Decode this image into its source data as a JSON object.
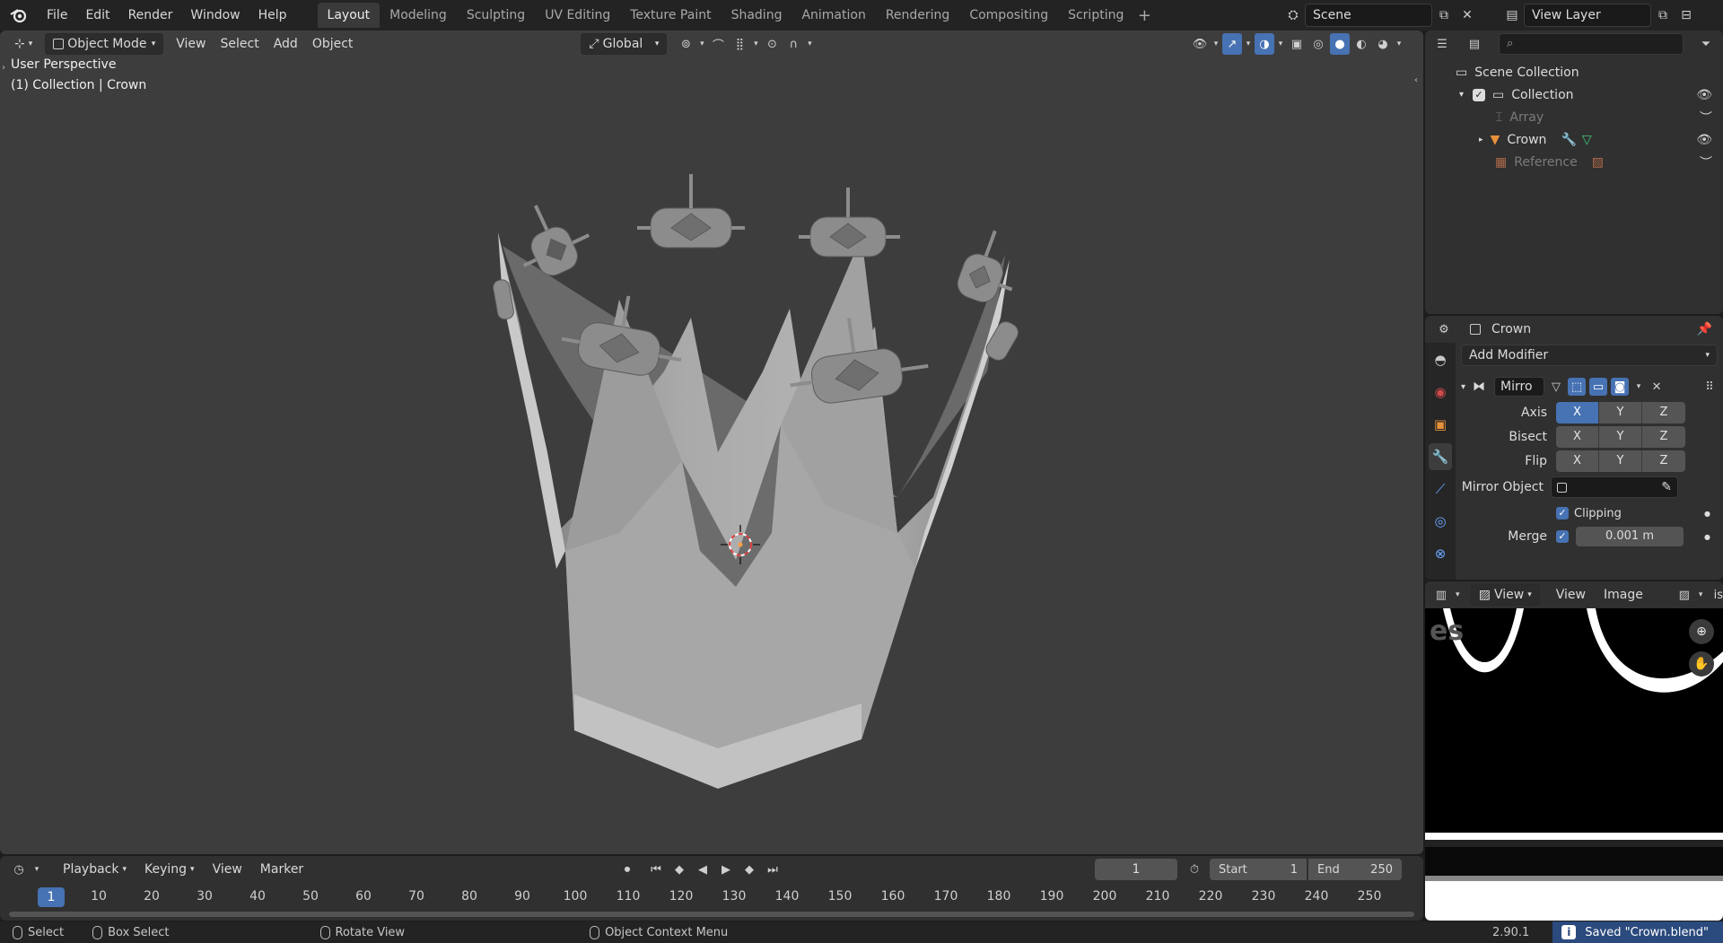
{
  "topbar": {
    "menus": [
      "File",
      "Edit",
      "Render",
      "Window",
      "Help"
    ],
    "workspaces": [
      "Layout",
      "Modeling",
      "Sculpting",
      "UV Editing",
      "Texture Paint",
      "Shading",
      "Animation",
      "Rendering",
      "Compositing",
      "Scripting"
    ],
    "active_workspace": "Layout",
    "scene_name": "Scene",
    "view_layer": "View Layer"
  },
  "viewport": {
    "mode": "Object Mode",
    "menus": [
      "View",
      "Select",
      "Add",
      "Object"
    ],
    "transform_orientation": "Global",
    "info_line1": "User Perspective",
    "info_line2": "(1) Collection | Crown"
  },
  "outliner": {
    "search_placeholder": "",
    "rows": [
      {
        "label": "Scene Collection"
      },
      {
        "label": "Collection"
      },
      {
        "label": "Array"
      },
      {
        "label": "Crown"
      },
      {
        "label": "Reference"
      }
    ]
  },
  "properties": {
    "object_name": "Crown",
    "add_modifier": "Add Modifier",
    "modifier_name": "Mirro",
    "axis_label": "Axis",
    "bisect_label": "Bisect",
    "flip_label": "Flip",
    "x": "X",
    "y": "Y",
    "z": "Z",
    "mirror_object_label": "Mirror Object",
    "clipping_label": "Clipping",
    "merge_label": "Merge",
    "merge_value": "0.001 m"
  },
  "image_editor": {
    "view_menu": "View",
    "menus": [
      "View",
      "Image"
    ],
    "cut_label": "is"
  },
  "timeline": {
    "menus": [
      "Playback",
      "Keying",
      "View",
      "Marker"
    ],
    "current_frame": "1",
    "start_label": "Start",
    "start_value": "1",
    "end_label": "End",
    "end_value": "250",
    "ruler": [
      "1",
      "10",
      "20",
      "30",
      "40",
      "50",
      "60",
      "70",
      "80",
      "90",
      "100",
      "110",
      "120",
      "130",
      "140",
      "150",
      "160",
      "170",
      "180",
      "190",
      "200",
      "210",
      "220",
      "230",
      "240",
      "250"
    ]
  },
  "statusbar": {
    "select": "Select",
    "box_select": "Box Select",
    "rotate_view": "Rotate View",
    "context_menu": "Object Context Menu",
    "version": "2.90.1",
    "saved_message": "Saved \"Crown.blend\""
  },
  "colors": {
    "accent": "#4772b3",
    "viewport_bg": "#3d3d3d",
    "panel_bg": "#303030"
  }
}
